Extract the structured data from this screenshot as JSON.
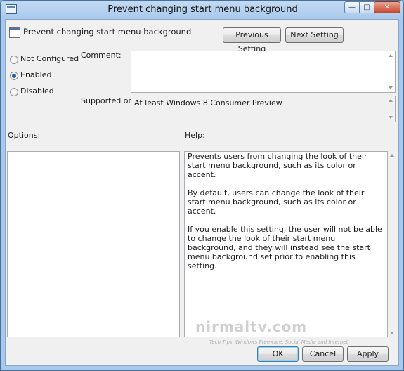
{
  "window": {
    "title": "Prevent changing start menu background",
    "minimize_icon": "minimize-icon",
    "maximize_icon": "maximize-icon",
    "close_icon": "close-icon",
    "minimize_glyph": "—",
    "maximize_glyph": "□",
    "close_glyph": "✕"
  },
  "header": {
    "policy_name": "Prevent changing start menu background",
    "previous_label": "Previous Setting",
    "next_label": "Next Setting"
  },
  "state": {
    "options": [
      {
        "label": "Not Configured",
        "selected": false
      },
      {
        "label": "Enabled",
        "selected": true
      },
      {
        "label": "Disabled",
        "selected": false
      }
    ]
  },
  "comment": {
    "label": "Comment:",
    "value": ""
  },
  "supported": {
    "label": "Supported on:",
    "value": "At least Windows 8 Consumer Preview"
  },
  "options_pane": {
    "label": "Options:"
  },
  "help_pane": {
    "label": "Help:",
    "paragraphs": [
      "Prevents users from changing the look of their start menu background, such as its color or accent.",
      "By default, users can change the look of their start menu background, such as its color or accent.",
      "If you enable this setting, the user will not be able to change the look of their start menu background, and they will instead see the start menu background set prior to enabling this setting."
    ]
  },
  "footer": {
    "ok_label": "OK",
    "cancel_label": "Cancel",
    "apply_label": "Apply"
  },
  "watermark": {
    "text": "nirmaltv.com",
    "tagline": "Tech Tips, Windows Freeware, Social Media and Internet"
  }
}
